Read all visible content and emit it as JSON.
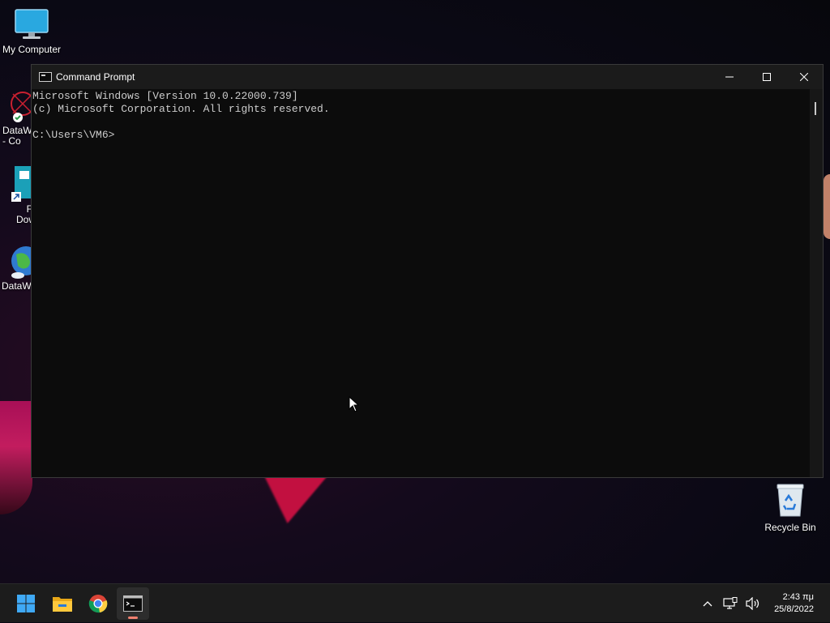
{
  "desktop": {
    "icons": [
      {
        "label": "My Computer"
      },
      {
        "label": "DataW\n- Co"
      },
      {
        "label": "Fr\nDow"
      },
      {
        "label": "DataW"
      },
      {
        "label": "Recycle Bin"
      }
    ]
  },
  "window": {
    "title": "Command Prompt",
    "controls": {
      "minimize": "—",
      "maximize": "☐",
      "close": "✕"
    },
    "console_lines": [
      "Microsoft Windows [Version 10.0.22000.739]",
      "(c) Microsoft Corporation. All rights reserved.",
      "",
      "C:\\Users\\VM6>"
    ]
  },
  "taskbar": {
    "apps": [
      {
        "name": "start-icon"
      },
      {
        "name": "file-explorer-icon"
      },
      {
        "name": "chrome-icon"
      },
      {
        "name": "command-prompt-icon",
        "active": true
      }
    ],
    "clock": {
      "time": "2:43 πμ",
      "date": "25/8/2022"
    }
  }
}
